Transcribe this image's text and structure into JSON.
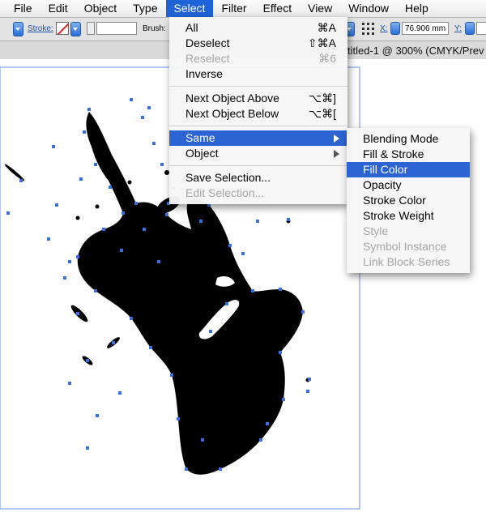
{
  "menubar": {
    "items": [
      "File",
      "Edit",
      "Object",
      "Type",
      "Select",
      "Filter",
      "Effect",
      "View",
      "Window",
      "Help"
    ],
    "active_index": 4
  },
  "controlbar": {
    "stroke_label": "Stroke:",
    "brush_label": "Brush:",
    "x_label": "X:",
    "x_value": "76.906 mm",
    "y_label": "Y:"
  },
  "document": {
    "title": "titled-1 @ 300% (CMYK/Prev"
  },
  "select_menu": {
    "items": [
      {
        "label": "All",
        "shortcut": "⌘A",
        "enabled": true
      },
      {
        "label": "Deselect",
        "shortcut": "⇧⌘A",
        "enabled": true
      },
      {
        "label": "Reselect",
        "shortcut": "⌘6",
        "enabled": false
      },
      {
        "label": "Inverse",
        "shortcut": "",
        "enabled": true
      },
      {
        "label": "Next Object Above",
        "shortcut": "⌥⌘]",
        "enabled": true
      },
      {
        "label": "Next Object Below",
        "shortcut": "⌥⌘[",
        "enabled": true
      },
      {
        "label": "Same",
        "shortcut": "",
        "enabled": true,
        "submenu": true,
        "highlighted": true
      },
      {
        "label": "Object",
        "shortcut": "",
        "enabled": true,
        "submenu": true
      },
      {
        "label": "Save Selection...",
        "shortcut": "",
        "enabled": true
      },
      {
        "label": "Edit Selection...",
        "shortcut": "",
        "enabled": false
      }
    ]
  },
  "same_submenu": {
    "items": [
      {
        "label": "Blending Mode",
        "enabled": true
      },
      {
        "label": "Fill & Stroke",
        "enabled": true
      },
      {
        "label": "Fill Color",
        "enabled": true,
        "highlighted": true
      },
      {
        "label": "Opacity",
        "enabled": true
      },
      {
        "label": "Stroke Color",
        "enabled": true
      },
      {
        "label": "Stroke Weight",
        "enabled": true
      },
      {
        "label": "Style",
        "enabled": false
      },
      {
        "label": "Symbol Instance",
        "enabled": false
      },
      {
        "label": "Link Block Series",
        "enabled": false
      }
    ]
  },
  "colors": {
    "highlight": "#2c64d3",
    "selection_anchor": "#3b6fe0",
    "ink": "#000000"
  }
}
